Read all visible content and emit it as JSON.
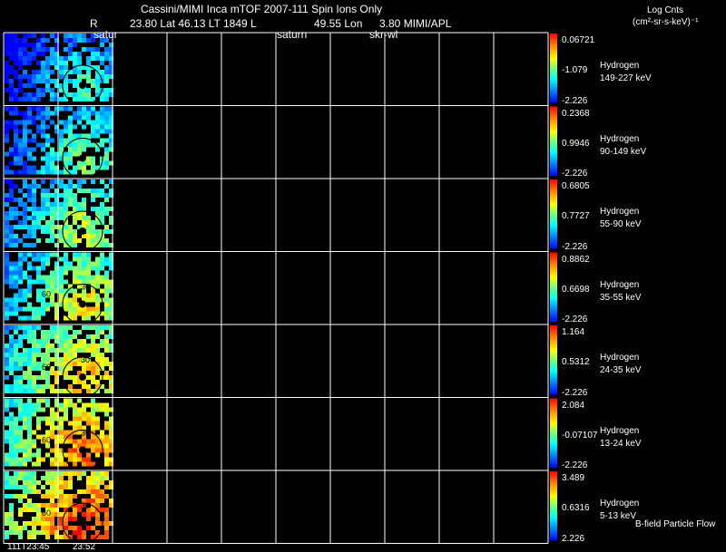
{
  "header": {
    "title": "Cassini/MIMI Inca mTOF  2007-111   Spin   Ions Only",
    "ephem_r_label": "R",
    "ephem_line": "23.80 Lat 46.13 LT 1849 L",
    "ephem_lon": "49.55 Lon",
    "ephem_tail": "3.80   MIMI/APL",
    "target_label_1": "satur",
    "target_label_2": "saturn",
    "target_label_3": "skr-wl",
    "units_title": "Log Cnts",
    "units": "(cm²-sr-s-keV)⁻¹"
  },
  "footer": {
    "time_start": "111T23:45",
    "time_next": "23:52",
    "flow_label": "B-field Particle Flow"
  },
  "colors": {
    "background": "#000000",
    "grid": "#ffffff",
    "colorbar": [
      "#ff0000",
      "#ff8000",
      "#ffff00",
      "#80ff80",
      "#00ffff",
      "#0080ff",
      "#0000ff"
    ]
  },
  "chart_data": {
    "type": "heatmap",
    "rows": [
      {
        "species": "Hydrogen",
        "energy": "149-227 keV",
        "max": "0.06721",
        "mid": "-1.079",
        "min": "-2.226"
      },
      {
        "species": "Hydrogen",
        "energy": "90-149 keV",
        "max": "0.2368",
        "mid": "0.9946",
        "min": "-2.226"
      },
      {
        "species": "Hydrogen",
        "energy": "55-90 keV",
        "max": "0.6805",
        "mid": "0.7727",
        "min": "-2.226"
      },
      {
        "species": "Hydrogen",
        "energy": "35-55 keV",
        "max": "0.8862",
        "mid": "0.6698",
        "min": "-2.226"
      },
      {
        "species": "Hydrogen",
        "energy": "24-35 keV",
        "max": "1.164",
        "mid": "0.5312",
        "min": "-2.226"
      },
      {
        "species": "Hydrogen",
        "energy": "13-24 keV",
        "max": "2.084",
        "mid": "-0.07107",
        "min": "-2.226"
      },
      {
        "species": "Hydrogen",
        "energy": "5-13 keV",
        "max": "3.489",
        "mid": "0.6316",
        "min": "2.226"
      }
    ],
    "columns": 10,
    "filled_columns": 2,
    "image_labels": [
      "30",
      "60"
    ],
    "note": ""
  }
}
